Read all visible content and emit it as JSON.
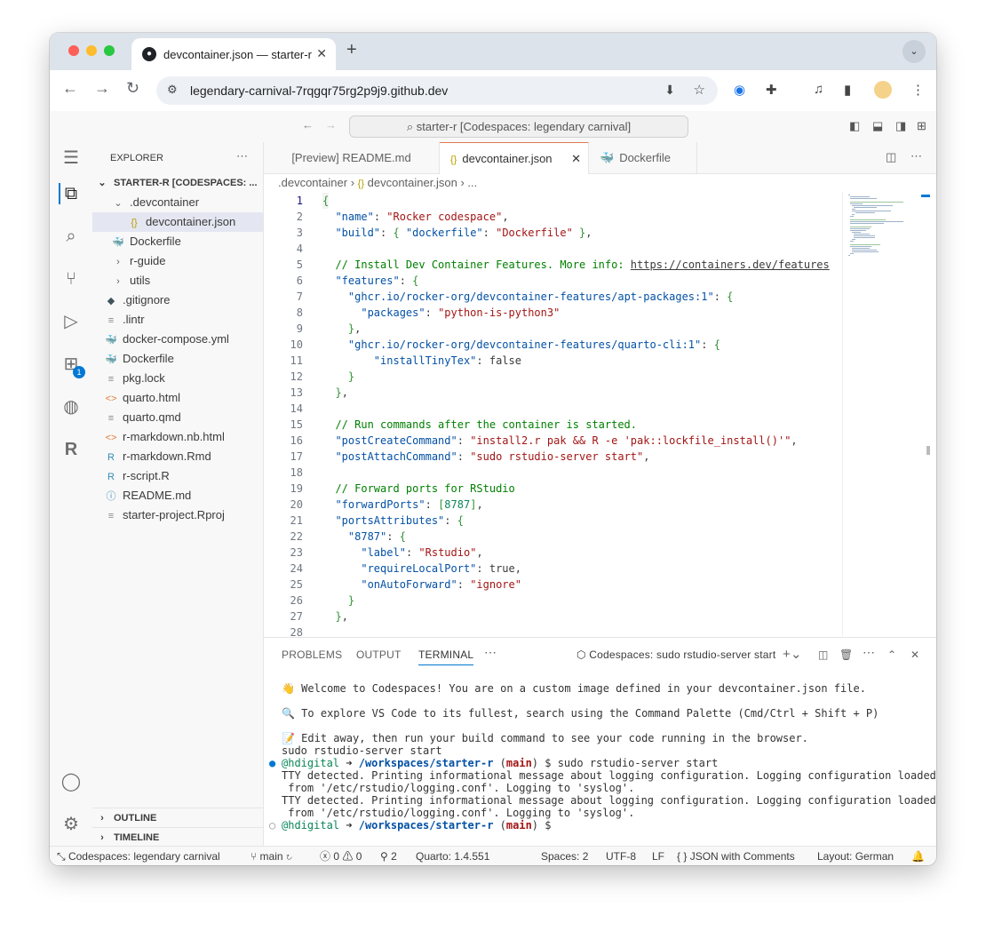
{
  "browser": {
    "tab_title": "devcontainer.json — starter-r",
    "url": "legendary-carnival-7rqgqr75rg2p9j9.github.dev"
  },
  "vscode": {
    "command_center": "starter-r [Codespaces: legendary carnival]",
    "explorer": {
      "title": "EXPLORER",
      "root": "STARTER-R [CODESPACES: ...",
      "items": [
        {
          "label": ".devcontainer",
          "icon": "chevron-down-icon"
        },
        {
          "label": "devcontainer.json",
          "icon": "json-braces-icon"
        },
        {
          "label": "Dockerfile",
          "icon": "docker-icon"
        },
        {
          "label": "r-guide",
          "icon": "chevron-right-icon"
        },
        {
          "label": "utils",
          "icon": "chevron-right-icon"
        },
        {
          "label": ".gitignore",
          "icon": "git-icon"
        },
        {
          "label": ".lintr",
          "icon": "file-lines-icon"
        },
        {
          "label": "docker-compose.yml",
          "icon": "docker-compose-icon"
        },
        {
          "label": "Dockerfile",
          "icon": "docker-icon"
        },
        {
          "label": "pkg.lock",
          "icon": "file-lines-icon"
        },
        {
          "label": "quarto.html",
          "icon": "html-icon"
        },
        {
          "label": "quarto.qmd",
          "icon": "file-lines-icon"
        },
        {
          "label": "r-markdown.nb.html",
          "icon": "html-icon"
        },
        {
          "label": "r-markdown.Rmd",
          "icon": "r-markdown-icon"
        },
        {
          "label": "r-script.R",
          "icon": "r-file-icon"
        },
        {
          "label": "README.md",
          "icon": "info-icon"
        },
        {
          "label": "starter-project.Rproj",
          "icon": "file-lines-icon"
        }
      ],
      "outline": "OUTLINE",
      "timeline": "TIMELINE"
    },
    "editor_tabs": [
      {
        "label": "[Preview] README.md"
      },
      {
        "label": "devcontainer.json"
      },
      {
        "label": "Dockerfile"
      }
    ],
    "breadcrumb": [
      ".devcontainer",
      "devcontainer.json",
      "..."
    ],
    "code_lines": [
      "{",
      "  \"name\": \"Rocker codespace\",",
      "  \"build\": { \"dockerfile\": \"Dockerfile\" },",
      "",
      "  // Install Dev Container Features. More info: https://containers.dev/features",
      "  \"features\": {",
      "    \"ghcr.io/rocker-org/devcontainer-features/apt-packages:1\": {",
      "      \"packages\": \"python-is-python3\"",
      "    },",
      "    \"ghcr.io/rocker-org/devcontainer-features/quarto-cli:1\": {",
      "        \"installTinyTex\": false",
      "    }",
      "  },",
      "",
      "  // Run commands after the container is started.",
      "  \"postCreateCommand\": \"install2.r pak && R -e 'pak::lockfile_install()'\",",
      "  \"postAttachCommand\": \"sudo rstudio-server start\",",
      "",
      "  // Forward ports for RStudio",
      "  \"forwardPorts\": [8787],",
      "  \"portsAttributes\": {",
      "    \"8787\": {",
      "      \"label\": \"Rstudio\",",
      "      \"requireLocalPort\": true,",
      "      \"onAutoForward\": \"ignore\"",
      "    }",
      "  },",
      ""
    ],
    "panel": {
      "tabs": [
        "PROBLEMS",
        "OUTPUT",
        "TERMINAL"
      ],
      "active_tab": "TERMINAL",
      "terminal_name": "Codespaces: sudo rstudio-server start",
      "terminal_lines": [
        "👋 Welcome to Codespaces! You are on a custom image defined in your devcontainer.json file.",
        "",
        "🔍 To explore VS Code to its fullest, search using the Command Palette (Cmd/Ctrl + Shift + P)",
        "",
        "📝 Edit away, then run your build command to see your code running in the browser.",
        "sudo rstudio-server start",
        "@hdigital ➜ /workspaces/starter-r (main) $ sudo rstudio-server start",
        "TTY detected. Printing informational message about logging configuration. Logging configuration loaded",
        " from '/etc/rstudio/logging.conf'. Logging to 'syslog'.",
        "TTY detected. Printing informational message about logging configuration. Logging configuration loaded",
        " from '/etc/rstudio/logging.conf'. Logging to 'syslog'.",
        "@hdigital ➜ /workspaces/starter-r (main) $ "
      ]
    },
    "statusbar": {
      "remote": "Codespaces: legendary carnival",
      "branch": "main",
      "errors": "0",
      "warnings": "0",
      "ports": "2",
      "quarto": "Quarto: 1.4.551",
      "spaces": "Spaces: 2",
      "encoding": "UTF-8",
      "eol": "LF",
      "language": "JSON with Comments",
      "layout": "Layout: German"
    },
    "extensions_badge": "1"
  },
  "colors": {
    "accent": "#0078d4",
    "tab_active_border": "#e07b53"
  }
}
